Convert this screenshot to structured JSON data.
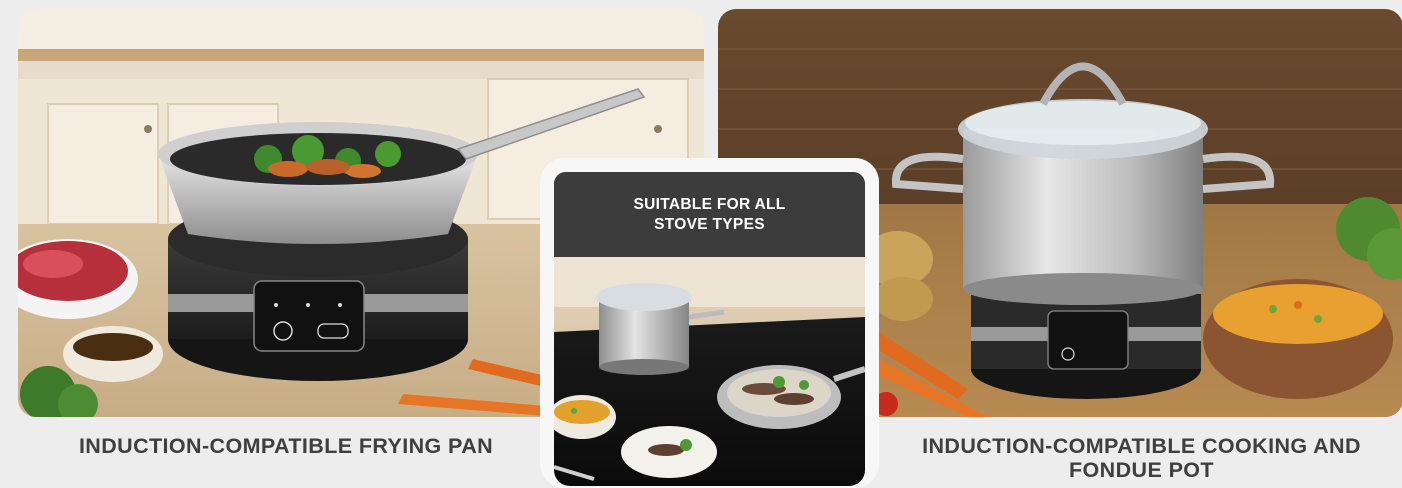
{
  "left_panel": {
    "caption": "INDUCTION-COMPATIBLE FRYING PAN",
    "scene": "frying-pan-on-induction-hob"
  },
  "center_panel": {
    "header": "SUITABLE FOR ALL STOVE TYPES",
    "scene": "pot-and-pan-on-glass-cooktop"
  },
  "right_panel": {
    "caption": "INDUCTION-COMPATIBLE COOKING AND FONDUE POT",
    "scene": "cooking-pot-on-induction-hob"
  },
  "colors": {
    "background": "#ededed",
    "caption_text": "#3f3f3f",
    "header_band": "#3c3c3c",
    "header_text": "#ffffff"
  }
}
